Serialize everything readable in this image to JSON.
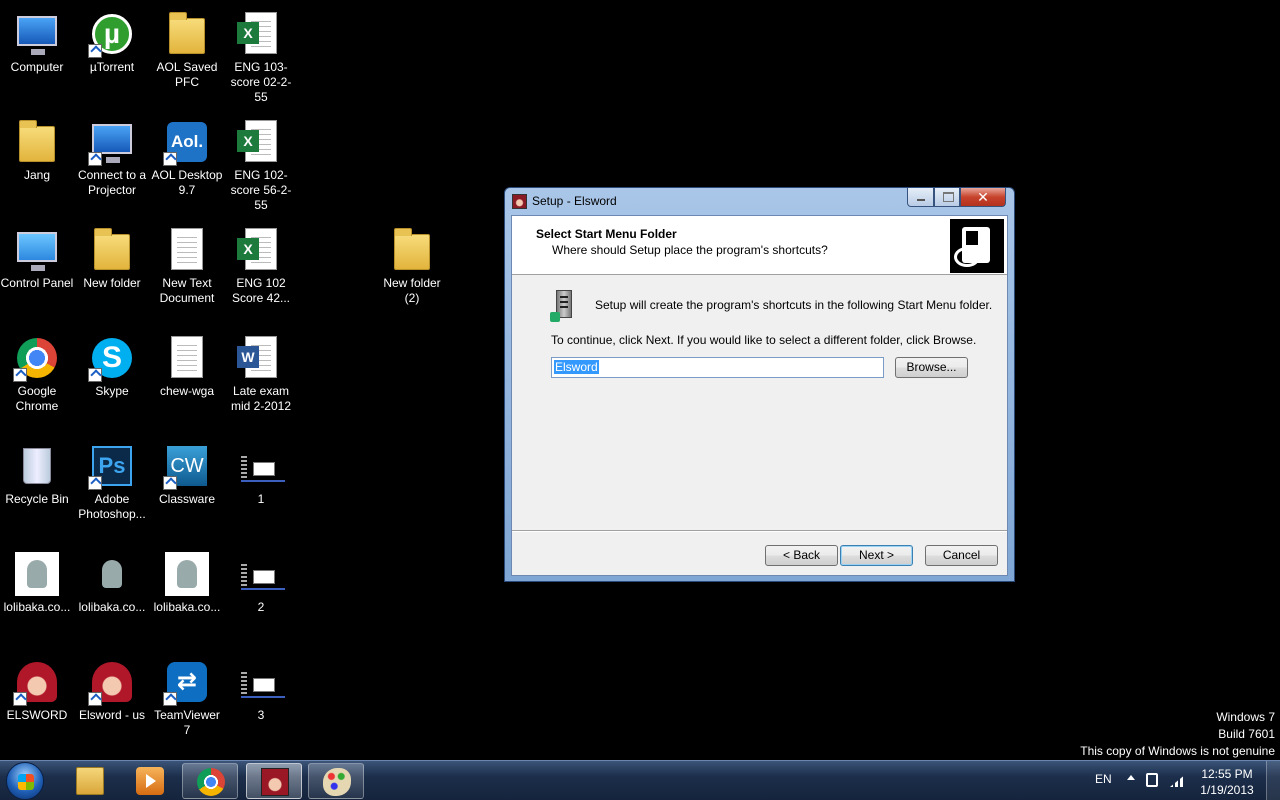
{
  "desktop": {
    "icons": {
      "computer": "Computer",
      "utorrent": "µTorrent",
      "aol_saved": "AOL Saved PFC",
      "eng103": "ENG 103-score 02-2-55",
      "jang": "Jang",
      "projector": "Connect to a Projector",
      "aol_desktop": "AOL Desktop 9.7",
      "eng102a": "ENG 102-score 56-2-55",
      "control_panel": "Control Panel",
      "new_folder": "New folder",
      "new_text": "New Text Document",
      "eng102b": "ENG 102 Score 42...",
      "new_folder2": "New folder (2)",
      "chrome": "Google Chrome",
      "skype": "Skype",
      "chew": "chew-wga",
      "late_exam": "Late exam mid 2-2012",
      "recycle": "Recycle Bin",
      "photoshop": "Adobe Photoshop...",
      "classware": "Classware",
      "file1": "1",
      "loli1": "lolibaka.co...",
      "loli2": "lolibaka.co...",
      "loli3": "lolibaka.co...",
      "file2": "2",
      "elsword": "ELSWORD",
      "elsword_us": "Elsword - us",
      "teamviewer": "TeamViewer 7",
      "file3": "3"
    },
    "glyphs": {
      "utorrent": "µ",
      "aol": "Aol.",
      "skype": "S",
      "photoshop": "Ps",
      "classware": "CW",
      "excel": "X",
      "word": "W",
      "teamviewer": "⇄"
    }
  },
  "watermark": {
    "line1": "Windows 7",
    "line2": "Build 7601",
    "line3": "This copy of Windows is not genuine"
  },
  "dialog": {
    "title": "Setup - Elsword",
    "close_glyph": "✕",
    "header_title": "Select Start Menu Folder",
    "header_subtitle": "Where should Setup place the program's shortcuts?",
    "info": "Setup will create the program's shortcuts in the following Start Menu folder.",
    "continue": "To continue, click Next. If you would like to select a different folder, click Browse.",
    "folder_value": "Elsword",
    "browse": "Browse...",
    "back": "< Back",
    "next": "Next >",
    "cancel": "Cancel"
  },
  "taskbar": {
    "language": "EN",
    "time": "12:55 PM",
    "date": "1/19/2013"
  }
}
